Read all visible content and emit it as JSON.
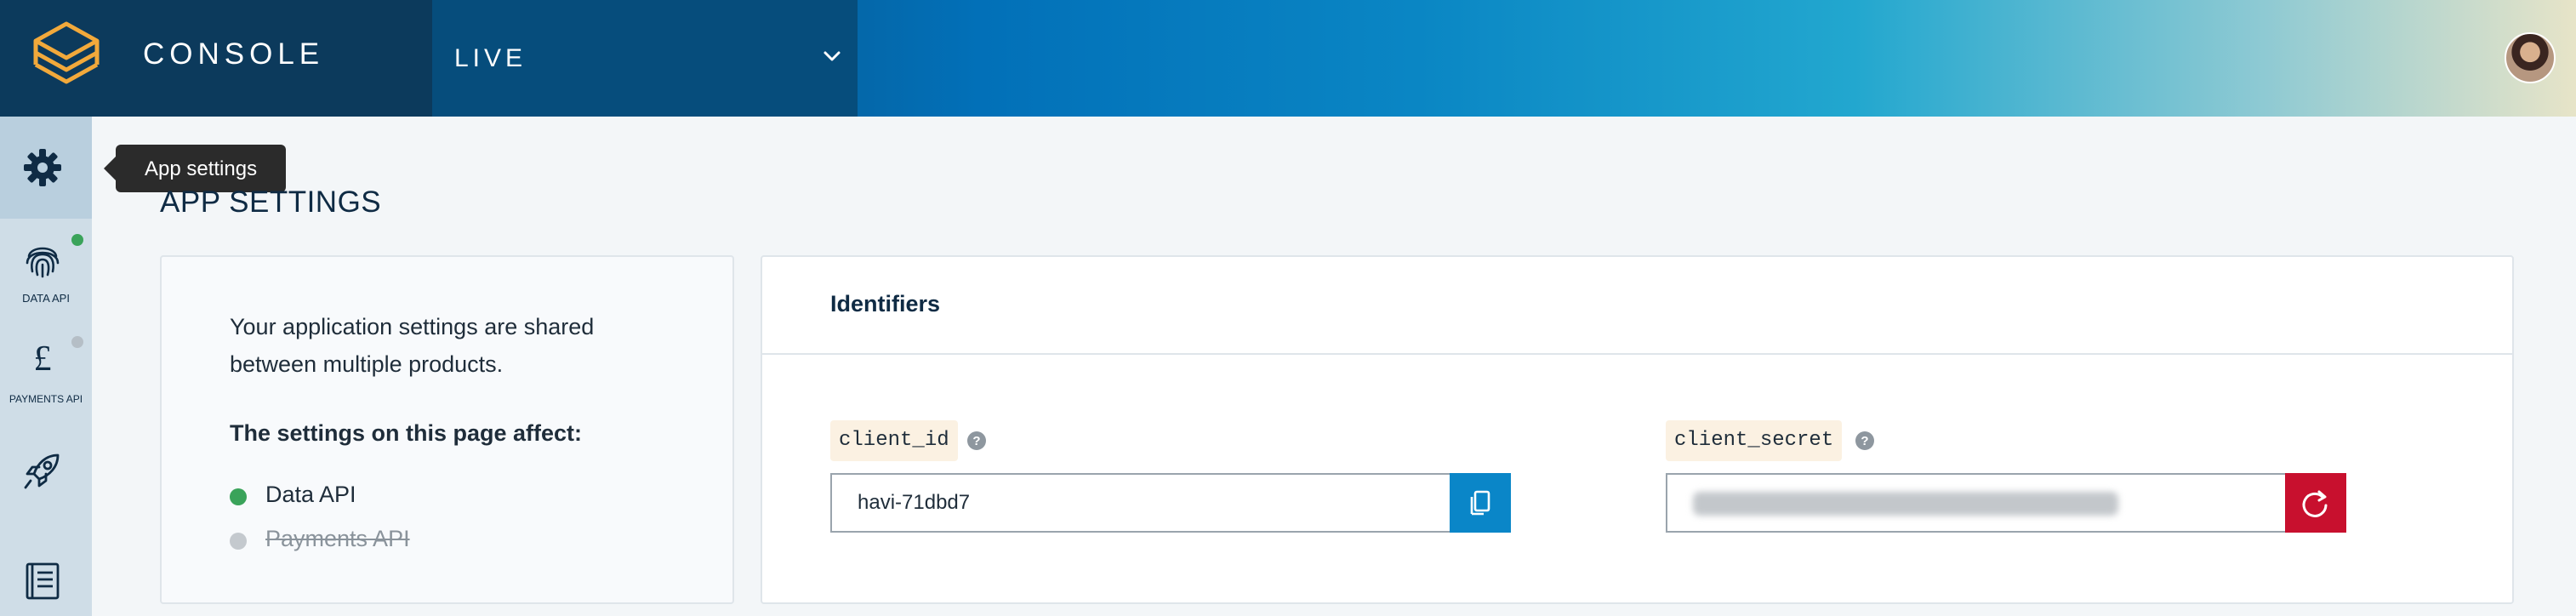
{
  "header": {
    "brand_title": "CONSOLE",
    "environment": "LIVE",
    "icons": {
      "logo": "layers-logo",
      "environment_dropdown": "chevron-down-icon",
      "avatar": "user-avatar"
    }
  },
  "sidebar": {
    "items": [
      {
        "name": "app-settings",
        "icon": "gear-icon",
        "caption": "",
        "active": true
      },
      {
        "name": "data-api",
        "icon": "fingerprint-icon",
        "caption": "DATA API",
        "status_color": "#3aa35a"
      },
      {
        "name": "payments-api",
        "icon": "pound-icon",
        "caption": "PAYMENTS API",
        "status_color": "#b5bec6"
      },
      {
        "name": "launch",
        "icon": "rocket-icon",
        "caption": ""
      },
      {
        "name": "docs",
        "icon": "book-icon",
        "caption": ""
      }
    ]
  },
  "tooltip": {
    "text": "App settings"
  },
  "main": {
    "page_title": "APP SETTINGS",
    "info": {
      "description": "Your application settings are shared between multiple products.",
      "affects_heading": "The settings on this page affect:",
      "products": [
        {
          "label": "Data API",
          "color": "#3aa35a",
          "enabled": true
        },
        {
          "label": "Payments API",
          "color": "#c4c9ce",
          "enabled": false
        }
      ]
    },
    "identifiers": {
      "title": "Identifiers",
      "client_id": {
        "label": "client_id",
        "value": "havi-71dbd7",
        "action_icon": "copy-icon",
        "action_color": "#0a86c8"
      },
      "client_secret": {
        "label": "client_secret",
        "value": "",
        "masked": true,
        "action_icon": "refresh-icon",
        "action_color": "#c8102e"
      }
    }
  },
  "colors": {
    "accent_blue": "#0a86c8",
    "danger_red": "#c8102e",
    "dark_navy": "#0c3a5c"
  }
}
